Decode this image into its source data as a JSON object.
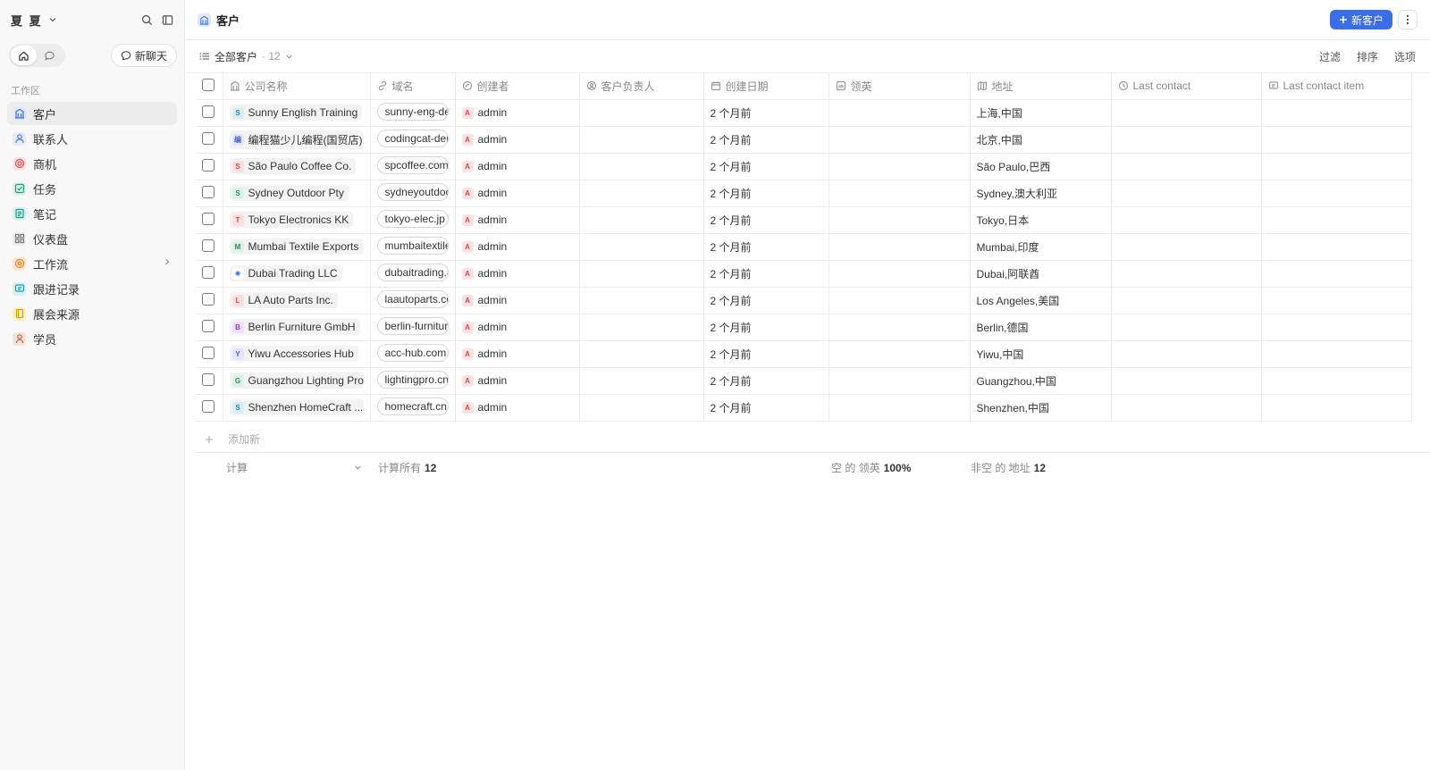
{
  "sidebar": {
    "workspace_name": "夏 夏",
    "new_chat_label": "新聊天",
    "section_label": "工作区",
    "items": [
      {
        "label": "客户",
        "icon": "building-icon",
        "color": "#3a6ee8",
        "bg": "#dfe8fc",
        "active": true
      },
      {
        "label": "联系人",
        "icon": "user-icon",
        "color": "#5577e6",
        "bg": "#e4ebfb"
      },
      {
        "label": "商机",
        "icon": "target-icon",
        "color": "#e5484d",
        "bg": "#fde3e3"
      },
      {
        "label": "任务",
        "icon": "checkbox-icon",
        "color": "#1ea374",
        "bg": "#dcf3ea"
      },
      {
        "label": "笔记",
        "icon": "note-icon",
        "color": "#12a08a",
        "bg": "#d8f1ec"
      },
      {
        "label": "仪表盘",
        "icon": "grid-icon",
        "color": "#777777",
        "bg": "#ececec"
      },
      {
        "label": "工作流",
        "icon": "gear-icon",
        "color": "#f07a1a",
        "bg": "#fde8d5"
      },
      {
        "label": "跟进记录",
        "icon": "message-icon",
        "color": "#1a9fb0",
        "bg": "#d8eff2"
      },
      {
        "label": "展会来源",
        "icon": "book-icon",
        "color": "#d9a300",
        "bg": "#fbefc8"
      },
      {
        "label": "学员",
        "icon": "person-icon",
        "color": "#b5634a",
        "bg": "#f7e2da"
      }
    ]
  },
  "header": {
    "title": "客户",
    "new_button": "新客户"
  },
  "view": {
    "name": "全部客户",
    "count": "· 12",
    "filter": "过滤",
    "sort": "排序",
    "options": "选项"
  },
  "columns": [
    {
      "label": "公司名称",
      "icon": "building-icon"
    },
    {
      "label": "域名",
      "icon": "link-icon"
    },
    {
      "label": "创建者",
      "icon": "creator-icon"
    },
    {
      "label": "客户负责人",
      "icon": "user-circle-icon"
    },
    {
      "label": "创建日期",
      "icon": "calendar-icon"
    },
    {
      "label": "领英",
      "icon": "linkedin-icon"
    },
    {
      "label": "地址",
      "icon": "map-icon"
    },
    {
      "label": "Last contact",
      "icon": "clock-icon"
    },
    {
      "label": "Last contact item",
      "icon": "comment-icon"
    }
  ],
  "rows": [
    {
      "company": "Sunny English Training",
      "letter": "S",
      "lc": "#2f7fb8",
      "lbg": "#dcecf7",
      "domain": "sunny-eng-demo.com",
      "creator": "admin",
      "created": "2 个月前",
      "address": "上海,中国"
    },
    {
      "company": "编程猫少儿编程(国贸店)",
      "letter": "编",
      "lc": "#4b5ec9",
      "lbg": "#e2e6fa",
      "domain": "codingcat-demo.com",
      "creator": "admin",
      "created": "2 个月前",
      "address": "北京,中国"
    },
    {
      "company": "São Paulo Coffee Co.",
      "letter": "S",
      "lc": "#d64545",
      "lbg": "#fbe0e0",
      "domain": "spcoffee.com.br",
      "creator": "admin",
      "created": "2 个月前",
      "address": "São Paulo,巴西"
    },
    {
      "company": "Sydney Outdoor Pty",
      "letter": "S",
      "lc": "#2e8a5c",
      "lbg": "#dcf1e6",
      "domain": "sydneyoutdoor.com.au",
      "creator": "admin",
      "created": "2 个月前",
      "address": "Sydney,澳大利亚"
    },
    {
      "company": "Tokyo Electronics KK",
      "letter": "T",
      "lc": "#d64545",
      "lbg": "#fbe0e0",
      "domain": "tokyo-elec.jp",
      "creator": "admin",
      "created": "2 个月前",
      "address": "Tokyo,日本"
    },
    {
      "company": "Mumbai Textile Exports",
      "letter": "M",
      "lc": "#2e8a5c",
      "lbg": "#dcf1e6",
      "domain": "mumbaitextile.in",
      "creator": "admin",
      "created": "2 个月前",
      "address": "Mumbai,印度"
    },
    {
      "company": "Dubai Trading LLC",
      "letter": "✺",
      "lc": "#3a6ee8",
      "lbg": "#ffffff",
      "domain": "dubaitrading.ae",
      "creator": "admin",
      "created": "2 个月前",
      "address": "Dubai,阿联酋"
    },
    {
      "company": "LA Auto Parts Inc.",
      "letter": "L",
      "lc": "#d64545",
      "lbg": "#fbe0e0",
      "domain": "laautoparts.com",
      "creator": "admin",
      "created": "2 个月前",
      "address": "Los Angeles,美国"
    },
    {
      "company": "Berlin Furniture GmbH",
      "letter": "B",
      "lc": "#8a3fc4",
      "lbg": "#efe0fa",
      "domain": "berlin-furniture.de",
      "creator": "admin",
      "created": "2 个月前",
      "address": "Berlin,德国"
    },
    {
      "company": "Yiwu Accessories Hub",
      "letter": "Y",
      "lc": "#4b5ec9",
      "lbg": "#e2e6fa",
      "domain": "acc-hub.com",
      "creator": "admin",
      "created": "2 个月前",
      "address": "Yiwu,中国"
    },
    {
      "company": "Guangzhou Lighting Pro",
      "letter": "G",
      "lc": "#2e8a5c",
      "lbg": "#dcf1e6",
      "domain": "lightingpro.cn",
      "creator": "admin",
      "created": "2 个月前",
      "address": "Guangzhou,中国"
    },
    {
      "company": "Shenzhen HomeCraft ...",
      "letter": "S",
      "lc": "#2f7fb8",
      "lbg": "#dcecf7",
      "domain": "homecraft.cn",
      "creator": "admin",
      "created": "2 个月前",
      "address": "Shenzhen,中国"
    }
  ],
  "add_new": "添加新",
  "calc": {
    "label": "计算",
    "all_label": "计算所有",
    "all_value": "12",
    "linkedin_label": "空 的 领英",
    "linkedin_value": "100%",
    "address_label": "非空 的 地址",
    "address_value": "12"
  }
}
